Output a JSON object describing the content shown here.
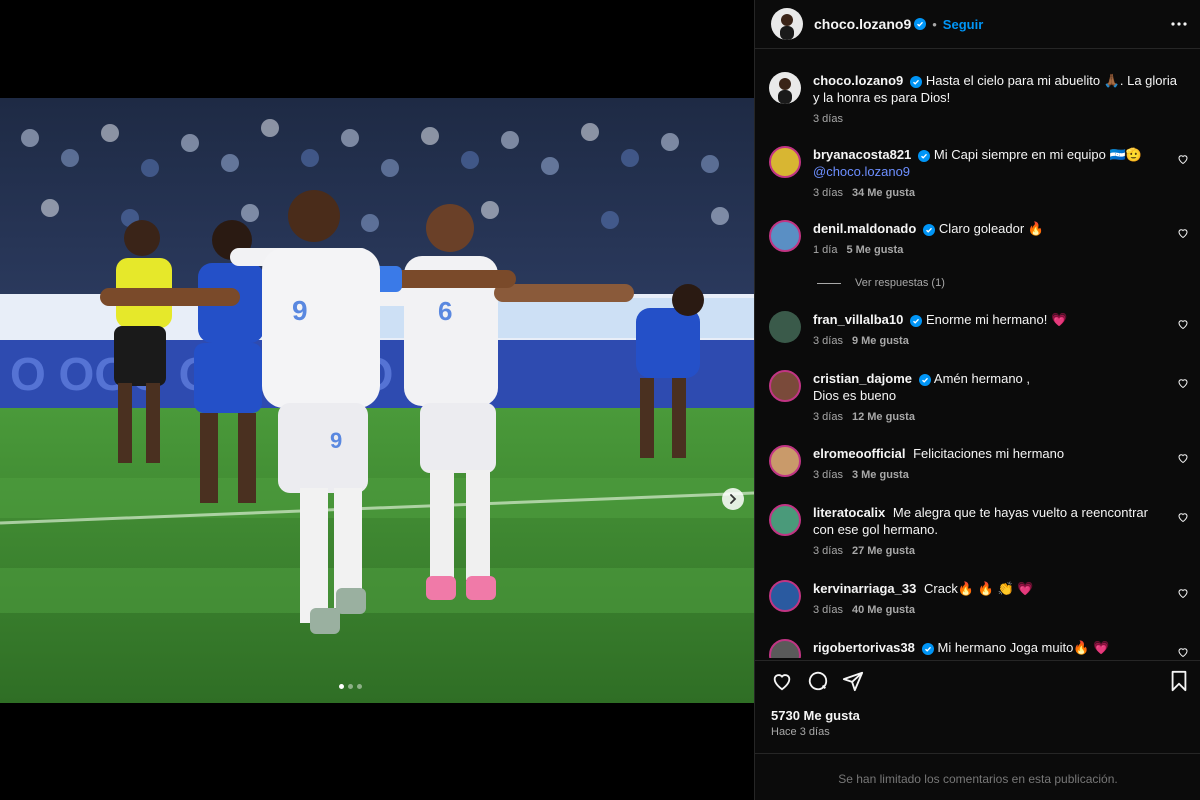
{
  "post": {
    "author": "choco.lozano9",
    "follow_label": "Seguir",
    "separator": "•",
    "caption_text": "Hasta el cielo para mi abuelito 🙏🏾. La gloria y la honra es para Dios!",
    "caption_time": "3 días",
    "likes_label": "5730 Me gusta",
    "date_label": "Hace 3 días",
    "limited_label": "Se han limitado los comentarios en esta publicación.",
    "image_count": 3,
    "active_image": 1
  },
  "replies_label": "Ver respuestas (1)",
  "comments": [
    {
      "user": "bryanacosta821",
      "verified": true,
      "text": "Mi Capi siempre en mi equipo 🇭🇳🫡",
      "mention": "@choco.lozano9",
      "time": "3 días",
      "likes": "34 Me gusta",
      "avatar_color": "#d8b632"
    },
    {
      "user": "denil.maldonado",
      "verified": true,
      "text": "Claro goleador 🔥",
      "mention": "",
      "time": "1 día",
      "likes": "5 Me gusta",
      "avatar_color": "#5a8fc4"
    },
    {
      "user": "fran_villalba10",
      "verified": true,
      "text": "Enorme mi hermano! 💗",
      "mention": "",
      "time": "3 días",
      "likes": "9 Me gusta",
      "avatar_color": "#3a5a4a"
    },
    {
      "user": "cristian_dajome",
      "verified": true,
      "text": "Amén hermano ,",
      "text2": "Dios es bueno",
      "mention": "",
      "time": "3 días",
      "likes": "12 Me gusta",
      "avatar_color": "#7a4a3a"
    },
    {
      "user": "elromeoofficial",
      "verified": false,
      "text": "Felicitaciones mi hermano",
      "mention": "",
      "time": "3 días",
      "likes": "3 Me gusta",
      "avatar_color": "#c99a6a"
    },
    {
      "user": "literatocalix",
      "verified": false,
      "text": "Me alegra que te hayas vuelto a reencontrar con ese gol hermano.",
      "mention": "",
      "time": "3 días",
      "likes": "27 Me gusta",
      "avatar_color": "#4a9a7a"
    },
    {
      "user": "kervinarriaga_33",
      "verified": false,
      "text": "Crack🔥 🔥 👏 💗",
      "mention": "",
      "time": "3 días",
      "likes": "40 Me gusta",
      "avatar_color": "#2a5aa0"
    },
    {
      "user": "rigobertorivas38",
      "verified": true,
      "text": "Mi hermano Joga muito🔥 💗",
      "mention": "",
      "time": "",
      "likes": "",
      "avatar_color": "#5a5a5a"
    }
  ],
  "colors": {
    "accent": "#0095f6",
    "mention": "#6d8fff",
    "muted": "#a8a8a8",
    "background": "#0b0b0b"
  },
  "icons": [
    "more-icon",
    "heart-icon",
    "comment-icon",
    "share-icon",
    "bookmark-icon",
    "chevron-right-icon",
    "verified-icon"
  ]
}
